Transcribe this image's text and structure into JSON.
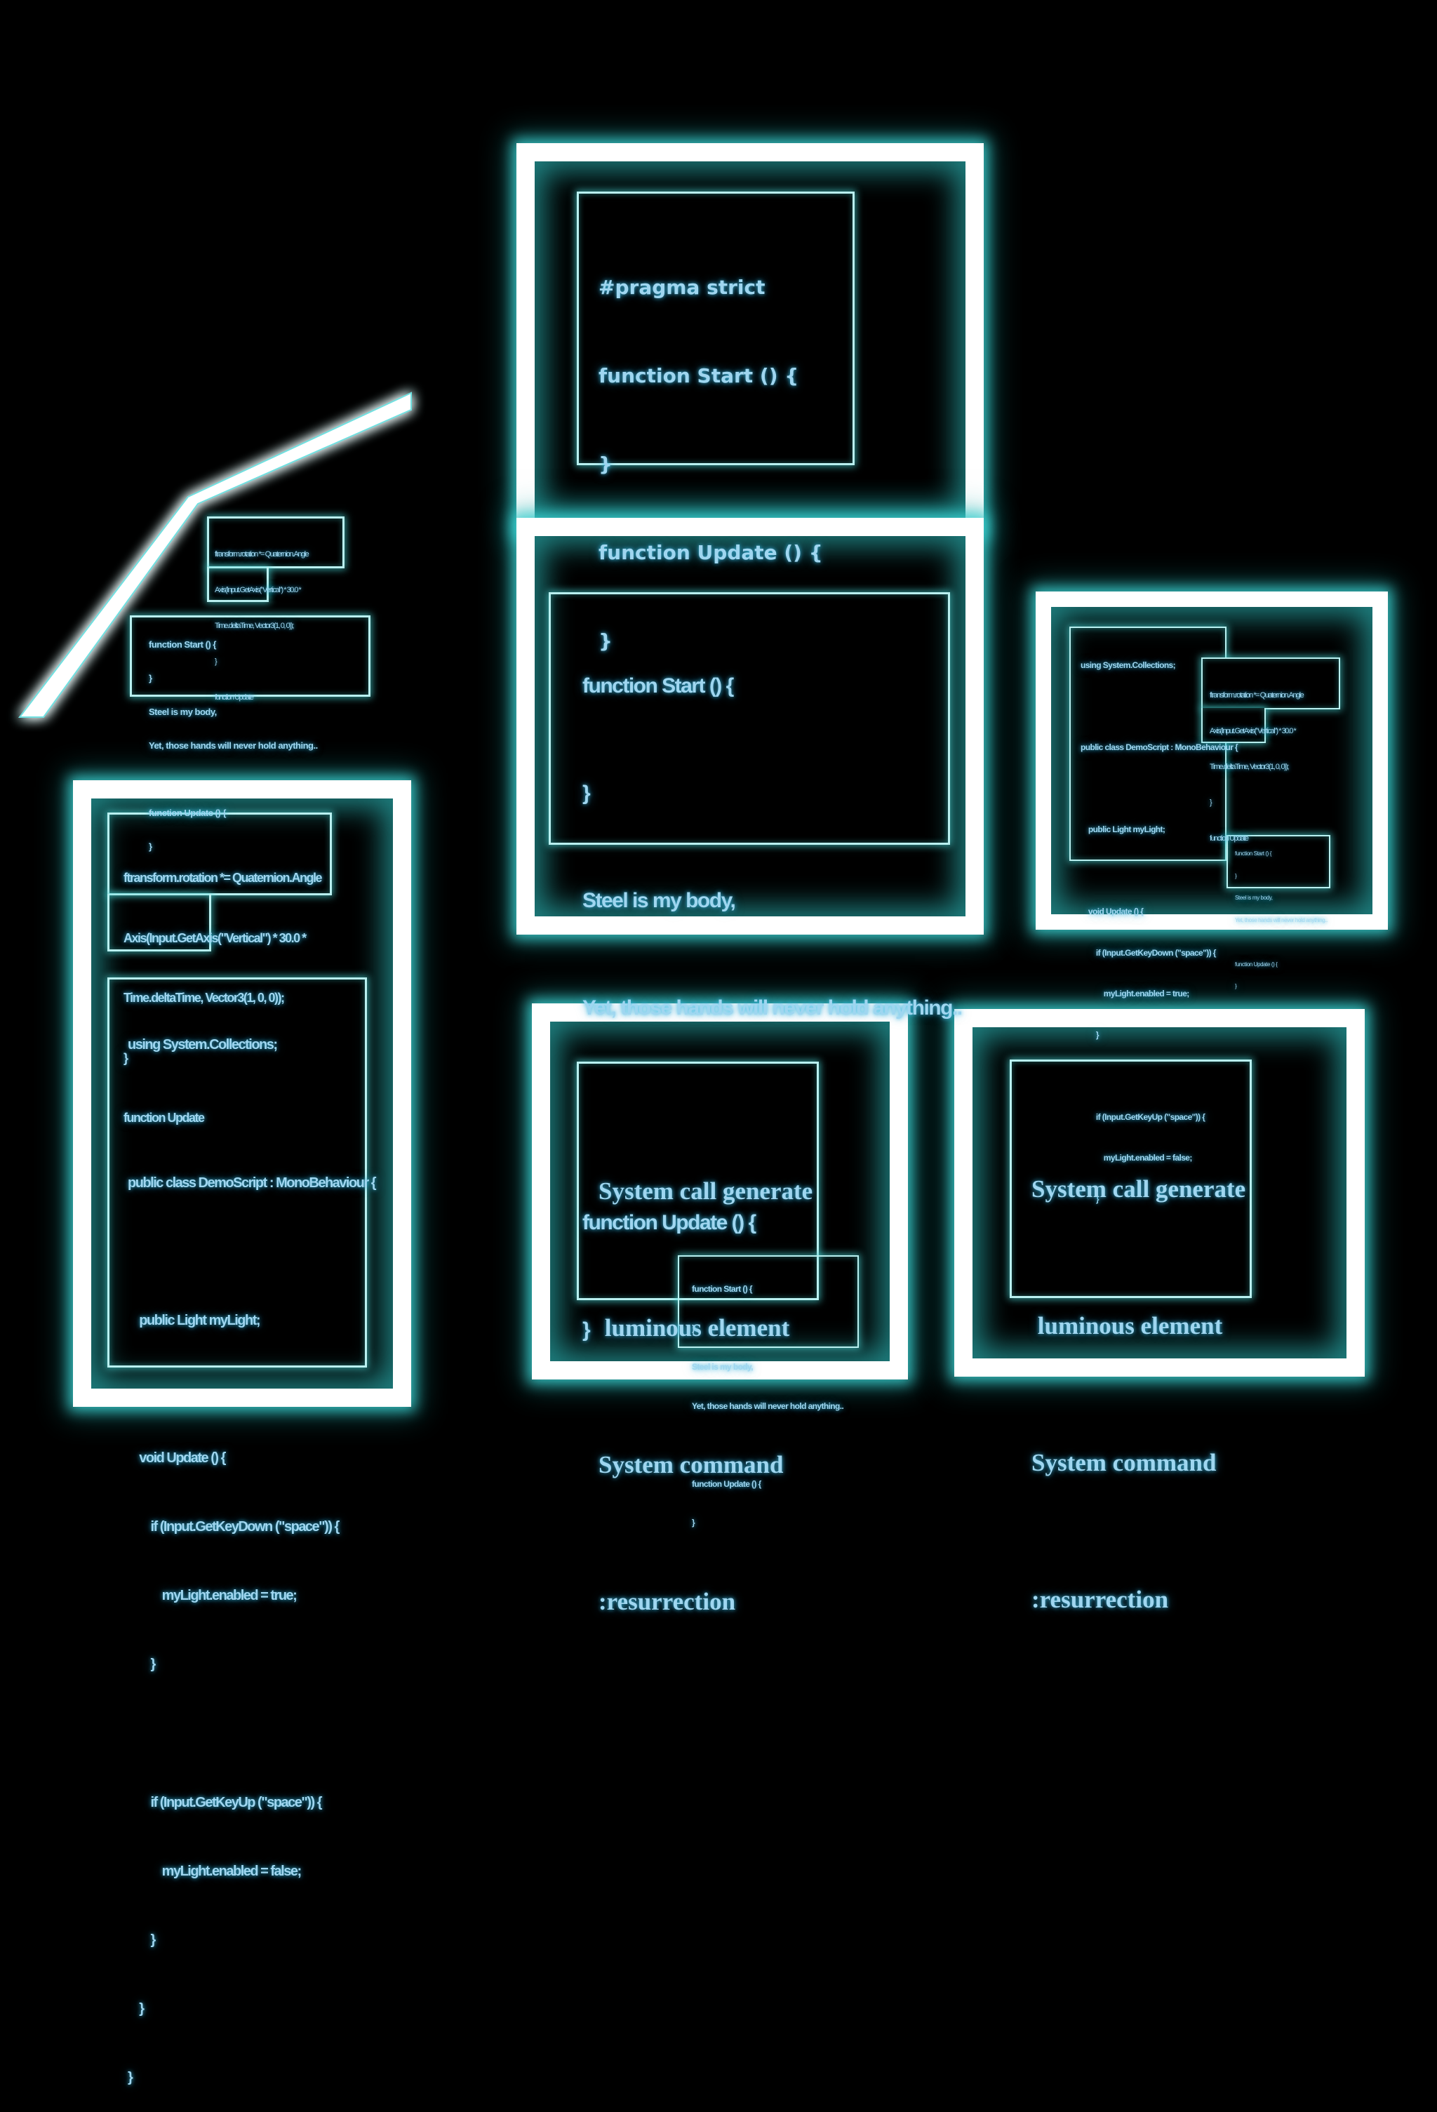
{
  "pragma_panel": {
    "lines": [
      "#pragma strict",
      "function Start () {",
      "}",
      "function Update () {",
      "}"
    ]
  },
  "steel_panel": {
    "lines": [
      "function Start () {",
      "}",
      "Steel is my body,",
      "Yet, those hands will never hold anything..",
      "",
      "function Update () {",
      "}"
    ]
  },
  "rotation_snippet": {
    "lines": [
      "ftransform.rotation *= Quaternion.Angle",
      "Axis(Input.GetAxis(\"Vertical\") * 30.0 *",
      "Time.deltaTime, Vector3(1, 0, 0));",
      "}",
      "function Update"
    ]
  },
  "csharp_script": {
    "lines": [
      "using System.Collections;",
      "",
      "public class DemoScript : MonoBehaviour {",
      "",
      "    public Light myLight;",
      "",
      "    void Update () {",
      "        if (Input.GetKeyDown (\"space\")) {",
      "            myLight.enabled = true;",
      "        }",
      "",
      "        if (Input.GetKeyUp (\"space\")) {",
      "            myLight.enabled = false;",
      "        }",
      "    }",
      "}"
    ]
  },
  "system_call": {
    "lines": [
      "System call generate",
      " luminous element",
      "System command",
      ":resurrection"
    ]
  },
  "colors": {
    "frame": "#ffffff",
    "glow": "#3cd2d2",
    "text": "#9fd6f0",
    "background": "#000000"
  }
}
